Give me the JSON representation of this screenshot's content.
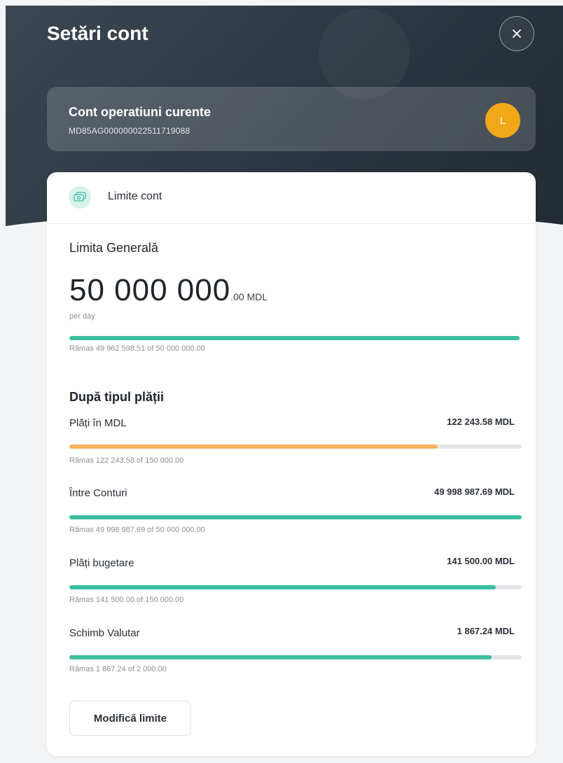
{
  "header": {
    "title": "Setări cont",
    "close_icon": "close-icon"
  },
  "account": {
    "name": "Cont operatiuni curente",
    "iban": "MD85AG000000022511719088",
    "avatar_letter": "L",
    "avatar_color": "#f0a818"
  },
  "limits": {
    "section_label": "Limite cont",
    "section_icon": "money-stack-icon",
    "general": {
      "title": "Limita Generală",
      "amount_int": "50 000 000",
      "amount_dec": ".00 MDL",
      "period": "per day",
      "remaining_text": "Rămas 49 962 598.51 of 50 000 000.00",
      "fill": 0.999,
      "color": "#3dbf9f"
    },
    "by_type_title": "După tipul plății",
    "items": [
      {
        "label": "Plăți în MDL",
        "amount": "122 243.58 MDL",
        "remaining_text": "Rămas 122 243.58 of 150 000.00",
        "fill": 0.815,
        "color": "#f5b35a"
      },
      {
        "label": "Între Conturi",
        "amount": "49 998 987.69 MDL",
        "remaining_text": "Rămas 49 998 987.69 of 50 000 000.00",
        "fill": 1.0,
        "color": "#3dbf9f"
      },
      {
        "label": "Plăți bugetare",
        "amount": "141 500.00 MDL",
        "remaining_text": "Rămas 141 500.00 of 150 000.00",
        "fill": 0.943,
        "color": "#3dbf9f"
      },
      {
        "label": "Schimb Valutar",
        "amount": "1 867.24 MDL",
        "remaining_text": "Rămas 1 867.24 of 2 000.00",
        "fill": 0.934,
        "color": "#3dbf9f"
      }
    ],
    "modify_button": "Modifică limite"
  }
}
